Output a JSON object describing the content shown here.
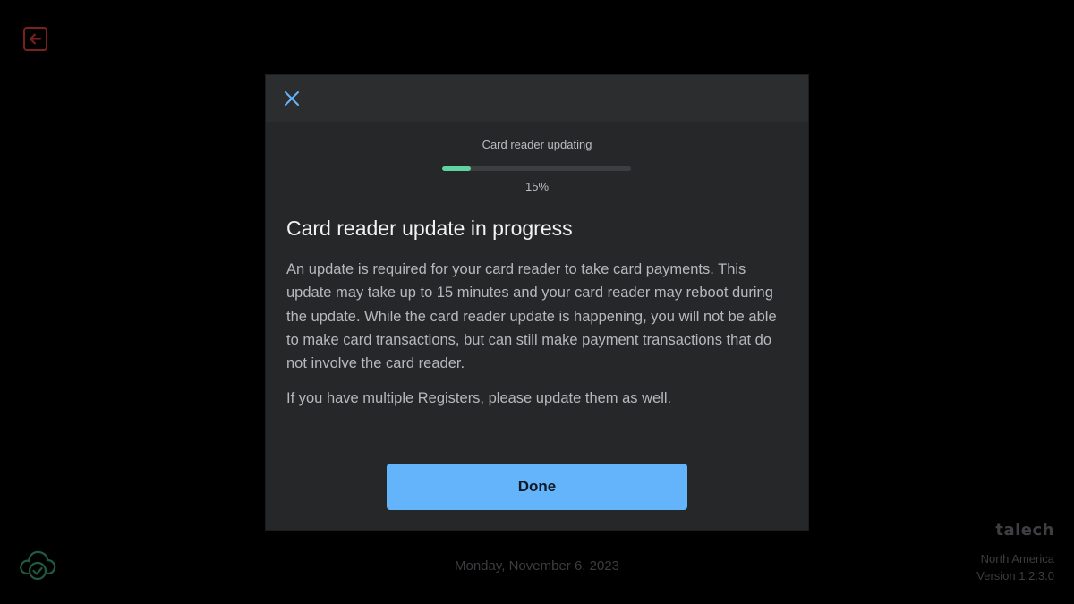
{
  "screen": {
    "date": "Monday, November 6, 2023",
    "brand": {
      "logo": "talech",
      "region": "North America",
      "version": "Version 1.2.3.0"
    },
    "icons": {
      "exit": "exit-icon",
      "cloud": "cloud-check-icon"
    },
    "colors": {
      "background": "#000000",
      "exit_icon": "#7a2020",
      "cloud_icon": "#1f5a42"
    }
  },
  "modal": {
    "close_icon": "close-icon",
    "progress": {
      "label": "Card reader updating",
      "percent_text": "15%",
      "value": 0.15,
      "fill_color": "#5fd3a0"
    },
    "title": "Card reader update in progress",
    "body": "An update is required for your card reader to take card payments. This update may take up to 15 minutes and your card reader may reboot during the update. While the card reader update is happening, you will not be able to make card transactions, but can still make payment transactions that do not involve the card reader.",
    "note": "If you have multiple Registers, please update them as well.",
    "done_label": "Done",
    "colors": {
      "accent": "#63b4fa",
      "surface": "#262729"
    }
  }
}
